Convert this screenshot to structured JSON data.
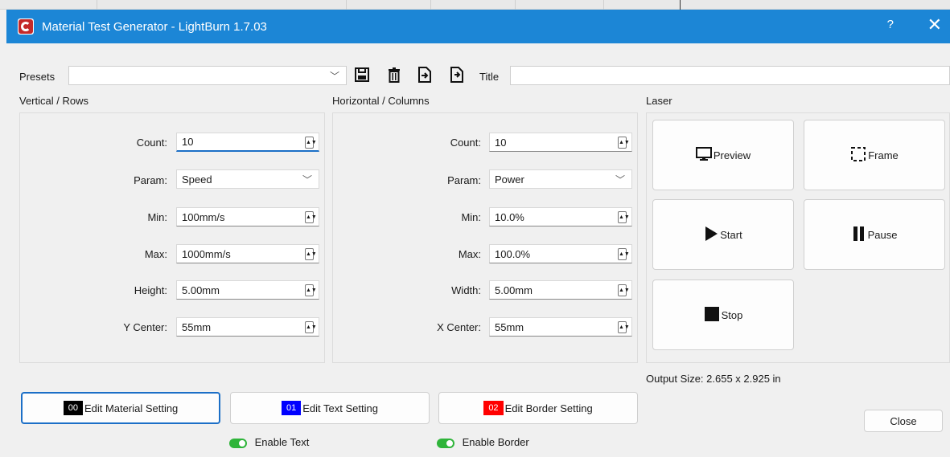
{
  "window": {
    "title": "Material Test Generator - LightBurn 1.7.03",
    "help_label": "?",
    "close_label": "✕"
  },
  "toolbar": {
    "presets_label": "Presets",
    "presets_value": "",
    "title_label": "Title",
    "title_value": "",
    "icons": [
      "save-icon",
      "delete-icon",
      "import-icon",
      "export-icon"
    ]
  },
  "vertical": {
    "group_label": "Vertical / Rows",
    "fields": [
      {
        "label": "Count:",
        "value": "10",
        "type": "spin"
      },
      {
        "label": "Param:",
        "value": "Speed",
        "type": "select"
      },
      {
        "label": "Min:",
        "value": "100mm/s",
        "type": "spin"
      },
      {
        "label": "Max:",
        "value": "1000mm/s",
        "type": "spin"
      },
      {
        "label": "Height:",
        "value": "5.00mm",
        "type": "spin"
      },
      {
        "label": "Y Center:",
        "value": "55mm",
        "type": "spin"
      }
    ]
  },
  "horizontal": {
    "group_label": "Horizontal / Columns",
    "fields": [
      {
        "label": "Count:",
        "value": "10",
        "type": "spin"
      },
      {
        "label": "Param:",
        "value": "Power",
        "type": "select"
      },
      {
        "label": "Min:",
        "value": "10.0%",
        "type": "spin"
      },
      {
        "label": "Max:",
        "value": "100.0%",
        "type": "spin"
      },
      {
        "label": "Width:",
        "value": "5.00mm",
        "type": "spin"
      },
      {
        "label": "X Center:",
        "value": "55mm",
        "type": "spin"
      }
    ]
  },
  "laser": {
    "group_label": "Laser",
    "preview_label": "Preview",
    "frame_label": "Frame",
    "start_label": "Start",
    "pause_label": "Pause",
    "stop_label": "Stop"
  },
  "output_size": "Output Size: 2.655 x 2.925 in",
  "bottom": {
    "material": {
      "swatch": "00",
      "label": "Edit Material Setting",
      "color": "#000000"
    },
    "text": {
      "swatch": "01",
      "label": "Edit Text Setting",
      "color": "#0000ff"
    },
    "border": {
      "swatch": "02",
      "label": "Edit Border Setting",
      "color": "#ff0000"
    },
    "enable_text": "Enable Text",
    "enable_border": "Enable Border",
    "close_label": "Close"
  },
  "colors": {
    "accent": "#1c86d6",
    "toggle_on": "#2fb43a"
  }
}
